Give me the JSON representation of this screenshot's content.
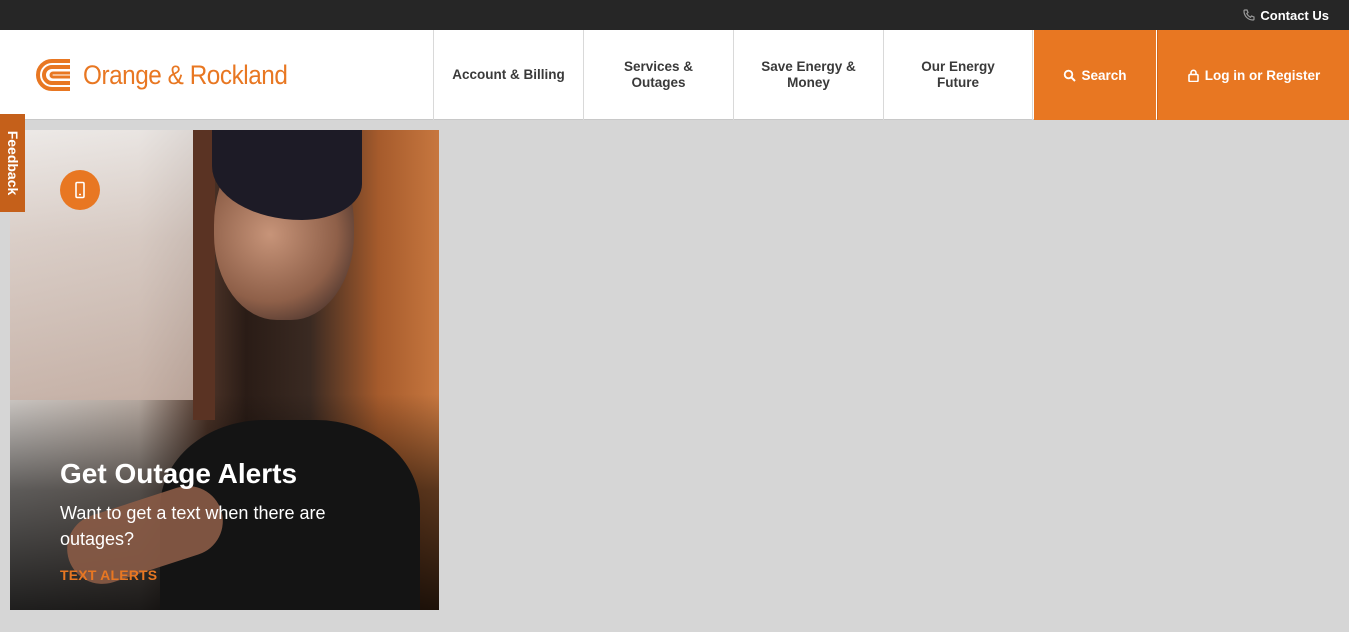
{
  "topbar": {
    "contact_label": "Contact Us",
    "icon": "phone-icon"
  },
  "header": {
    "logo_text": "Orange & Rockland",
    "nav": [
      {
        "label": "Account & Billing"
      },
      {
        "label": "Services & Outages"
      },
      {
        "label": "Save Energy & Money"
      },
      {
        "label": "Our Energy Future"
      }
    ],
    "search_label": "Search",
    "login_label": "Log in or Register"
  },
  "feedback_label": "Feedback",
  "card": {
    "icon": "mobile-phone-icon",
    "title": "Get Outage Alerts",
    "description": "Want to get a text when there are outages?",
    "link_label": "TEXT ALERTS"
  },
  "colors": {
    "accent": "#e87722",
    "topbar": "#262626",
    "page_bg": "#d6d6d6"
  }
}
